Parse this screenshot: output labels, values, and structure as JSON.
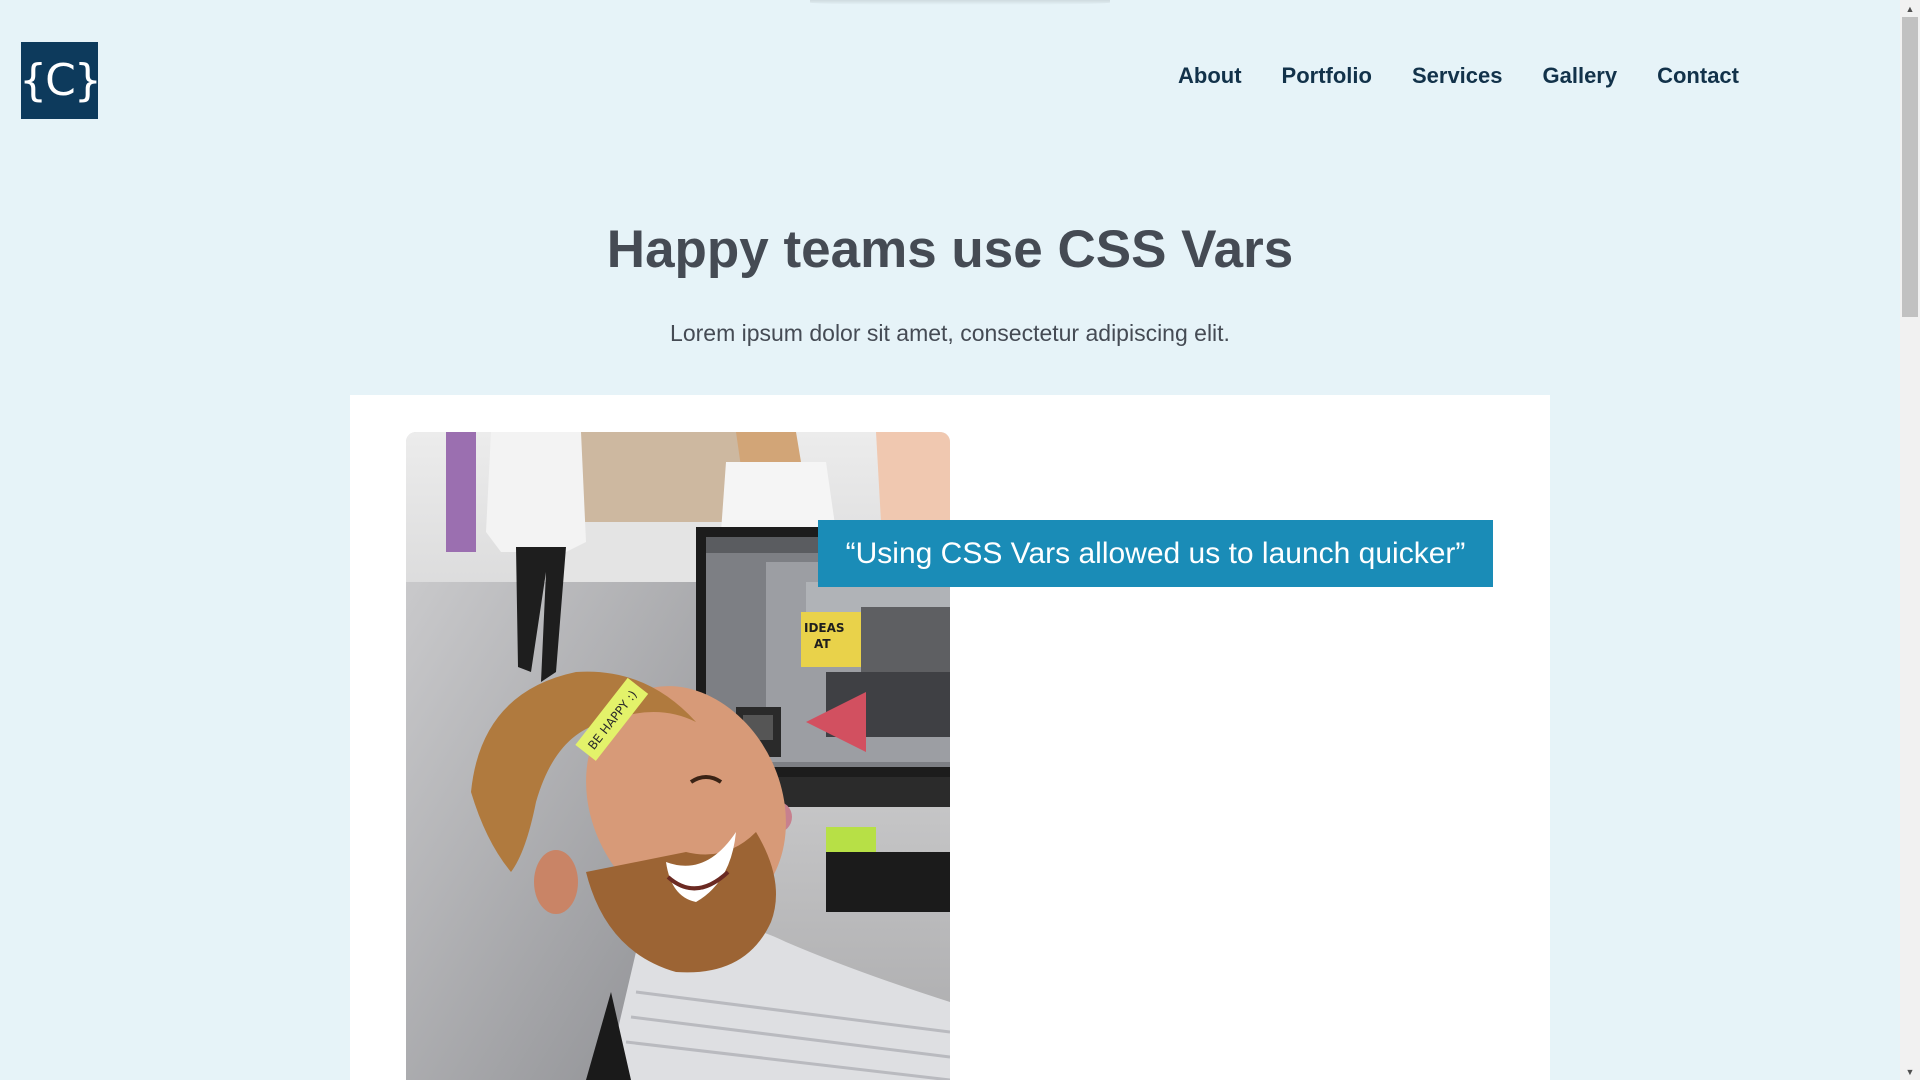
{
  "header": {
    "logo_text": "{C}",
    "nav": [
      {
        "label": "About"
      },
      {
        "label": "Portfolio"
      },
      {
        "label": "Services"
      },
      {
        "label": "Gallery"
      },
      {
        "label": "Contact"
      }
    ]
  },
  "hero": {
    "title": "Happy teams use CSS Vars",
    "subtitle": "Lorem ipsum dolor sit amet, consectetur adipiscing elit."
  },
  "testimonial": {
    "quote": "“Using CSS Vars allowed us to launch quicker”",
    "photo_sticky_note": "BE HAPPY :)",
    "photo_poster_text": "IDEAS AT"
  },
  "colors": {
    "background": "#e6f3f8",
    "logo_background": "#0d3a5c",
    "nav_text": "#12324a",
    "heading_text": "#454b54",
    "quote_background": "#1a8cb7",
    "card_background": "#ffffff"
  },
  "icons": {
    "scroll_up": "triangle-up-icon",
    "scroll_down": "triangle-down-icon"
  }
}
